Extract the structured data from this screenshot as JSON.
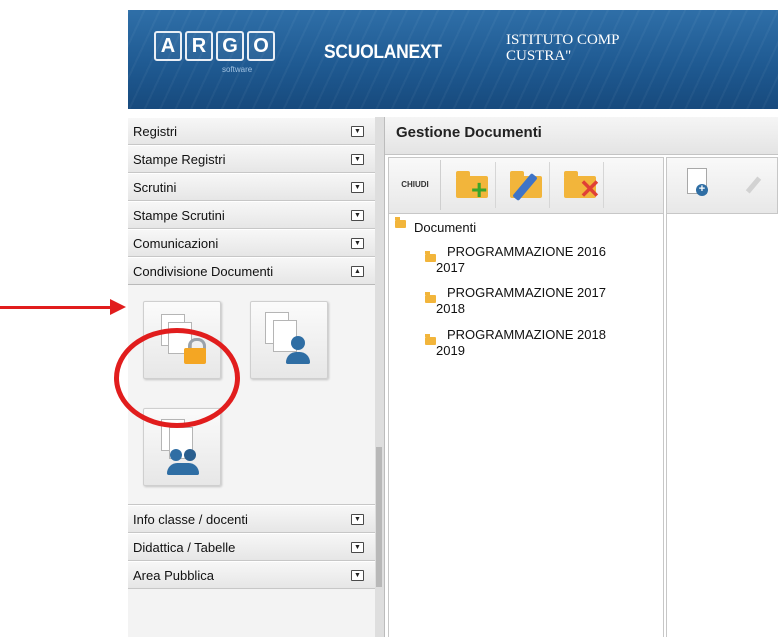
{
  "header": {
    "argo_letters": [
      "A",
      "R",
      "G",
      "O"
    ],
    "argo_sub": "software",
    "brand": "SCUOLANEXT",
    "institute_line1": "ISTITUTO COMP",
    "institute_line2": "CUSTRA\""
  },
  "sidebar": {
    "sections_top": [
      {
        "label": "Registri"
      },
      {
        "label": "Stampe Registri"
      },
      {
        "label": "Scrutini"
      },
      {
        "label": "Stampe Scrutini"
      },
      {
        "label": "Comunicazioni"
      },
      {
        "label": "Condivisione Documenti",
        "expanded": true
      }
    ],
    "sections_bottom": [
      {
        "label": "Info classe / docenti"
      },
      {
        "label": "Didattica / Tabelle"
      },
      {
        "label": "Area Pubblica"
      }
    ],
    "panel_buttons": [
      {
        "icon": "document-lock-icon"
      },
      {
        "icon": "document-user-icon"
      },
      {
        "icon": "document-group-icon"
      }
    ]
  },
  "main": {
    "title": "Gestione Documenti",
    "toolbar": {
      "chiudi_label": "CHIUDI",
      "buttons": [
        {
          "icon": "folder-add-icon"
        },
        {
          "icon": "folder-edit-icon"
        },
        {
          "icon": "folder-delete-icon"
        }
      ]
    },
    "tree": {
      "root": "Documenti",
      "children": [
        {
          "line1": "PROGRAMMAZIONE 2016",
          "line2": "2017"
        },
        {
          "line1": "PROGRAMMAZIONE 2017",
          "line2": "2018"
        },
        {
          "line1": "PROGRAMMAZIONE 2018",
          "line2": "2019"
        }
      ]
    },
    "right_toolbar": {
      "buttons": [
        {
          "icon": "new-document-icon"
        },
        {
          "icon": "edit-document-icon"
        }
      ]
    }
  },
  "colors": {
    "header_blue": "#1f5a92",
    "folder_yellow": "#f2b53b",
    "annotation_red": "#e11d1d"
  }
}
